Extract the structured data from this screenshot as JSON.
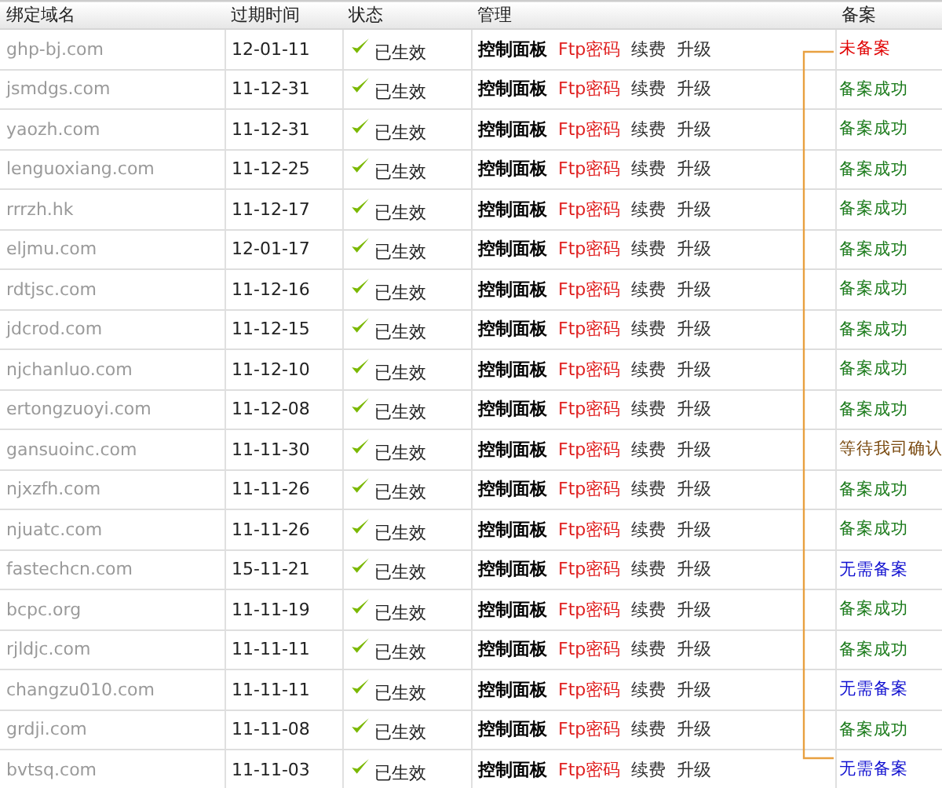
{
  "columns": [
    "绑定域名",
    "过期时间",
    "状态",
    "管理",
    "备案"
  ],
  "rows": [
    {
      "domain": "ghp-bj.com",
      "expires": "12-01-11",
      "status": "已生效",
      "actions": [
        "控制面板",
        "Ftp密码",
        "续费",
        "升级"
      ],
      "record": {
        "text": "未备案",
        "color": "#e00000"
      }
    },
    {
      "domain": "jsmdgs.com",
      "expires": "11-12-31",
      "status": "已生效",
      "actions": [
        "控制面板",
        "Ftp密码",
        "续费",
        "升级"
      ],
      "record": {
        "text": "备案成功",
        "color": "#1a7a1a"
      }
    },
    {
      "domain": "yaozh.com",
      "expires": "11-12-31",
      "status": "已生效",
      "actions": [
        "控制面板",
        "Ftp密码",
        "续费",
        "升级"
      ],
      "record": {
        "text": "备案成功",
        "color": "#1a7a1a"
      }
    },
    {
      "domain": "lenguoxiang.com",
      "expires": "11-12-25",
      "status": "已生效",
      "actions": [
        "控制面板",
        "Ftp密码",
        "续费",
        "升级"
      ],
      "record": {
        "text": "备案成功",
        "color": "#1a7a1a"
      }
    },
    {
      "domain": "rrrzh.hk",
      "expires": "11-12-17",
      "status": "已生效",
      "actions": [
        "控制面板",
        "Ftp密码",
        "续费",
        "升级"
      ],
      "record": {
        "text": "备案成功",
        "color": "#1a7a1a"
      }
    },
    {
      "domain": "eljmu.com",
      "expires": "12-01-17",
      "status": "已生效",
      "actions": [
        "控制面板",
        "Ftp密码",
        "续费",
        "升级"
      ],
      "record": {
        "text": "备案成功",
        "color": "#1a7a1a"
      }
    },
    {
      "domain": "rdtjsc.com",
      "expires": "11-12-16",
      "status": "已生效",
      "actions": [
        "控制面板",
        "Ftp密码",
        "续费",
        "升级"
      ],
      "record": {
        "text": "备案成功",
        "color": "#1a7a1a"
      }
    },
    {
      "domain": "jdcrod.com",
      "expires": "11-12-15",
      "status": "已生效",
      "actions": [
        "控制面板",
        "Ftp密码",
        "续费",
        "升级"
      ],
      "record": {
        "text": "备案成功",
        "color": "#1a7a1a"
      }
    },
    {
      "domain": "njchanluo.com",
      "expires": "11-12-10",
      "status": "已生效",
      "actions": [
        "控制面板",
        "Ftp密码",
        "续费",
        "升级"
      ],
      "record": {
        "text": "备案成功",
        "color": "#1a7a1a"
      }
    },
    {
      "domain": "ertongzuoyi.com",
      "expires": "11-12-08",
      "status": "已生效",
      "actions": [
        "控制面板",
        "Ftp密码",
        "续费",
        "升级"
      ],
      "record": {
        "text": "备案成功",
        "color": "#1a7a1a"
      }
    },
    {
      "domain": "gansuoinc.com",
      "expires": "11-11-30",
      "status": "已生效",
      "actions": [
        "控制面板",
        "Ftp密码",
        "续费",
        "升级"
      ],
      "record": {
        "text": "等待我司确认",
        "color": "#7a4a10"
      }
    },
    {
      "domain": "njxzfh.com",
      "expires": "11-11-26",
      "status": "已生效",
      "actions": [
        "控制面板",
        "Ftp密码",
        "续费",
        "升级"
      ],
      "record": {
        "text": "备案成功",
        "color": "#1a7a1a"
      }
    },
    {
      "domain": "njuatc.com",
      "expires": "11-11-26",
      "status": "已生效",
      "actions": [
        "控制面板",
        "Ftp密码",
        "续费",
        "升级"
      ],
      "record": {
        "text": "备案成功",
        "color": "#1a7a1a"
      }
    },
    {
      "domain": "fastechcn.com",
      "expires": "15-11-21",
      "status": "已生效",
      "actions": [
        "控制面板",
        "Ftp密码",
        "续费",
        "升级"
      ],
      "record": {
        "text": "无需备案",
        "color": "#1010d0"
      }
    },
    {
      "domain": "bcpc.org",
      "expires": "11-11-19",
      "status": "已生效",
      "actions": [
        "控制面板",
        "Ftp密码",
        "续费",
        "升级"
      ],
      "record": {
        "text": "备案成功",
        "color": "#1a7a1a"
      }
    },
    {
      "domain": "rjldjc.com",
      "expires": "11-11-11",
      "status": "已生效",
      "actions": [
        "控制面板",
        "Ftp密码",
        "续费",
        "升级"
      ],
      "record": {
        "text": "备案成功",
        "color": "#1a7a1a"
      }
    },
    {
      "domain": "changzu010.com",
      "expires": "11-11-11",
      "status": "已生效",
      "actions": [
        "控制面板",
        "Ftp密码",
        "续费",
        "升级"
      ],
      "record": {
        "text": "无需备案",
        "color": "#1010d0"
      }
    },
    {
      "domain": "grdji.com",
      "expires": "11-11-08",
      "status": "已生效",
      "actions": [
        "控制面板",
        "Ftp密码",
        "续费",
        "升级"
      ],
      "record": {
        "text": "备案成功",
        "color": "#1a7a1a"
      }
    },
    {
      "domain": "bvtsq.com",
      "expires": "11-11-03",
      "status": "已生效",
      "actions": [
        "控制面板",
        "Ftp密码",
        "续费",
        "升级"
      ],
      "record": {
        "text": "无需备案",
        "color": "#1010d0"
      }
    }
  ]
}
